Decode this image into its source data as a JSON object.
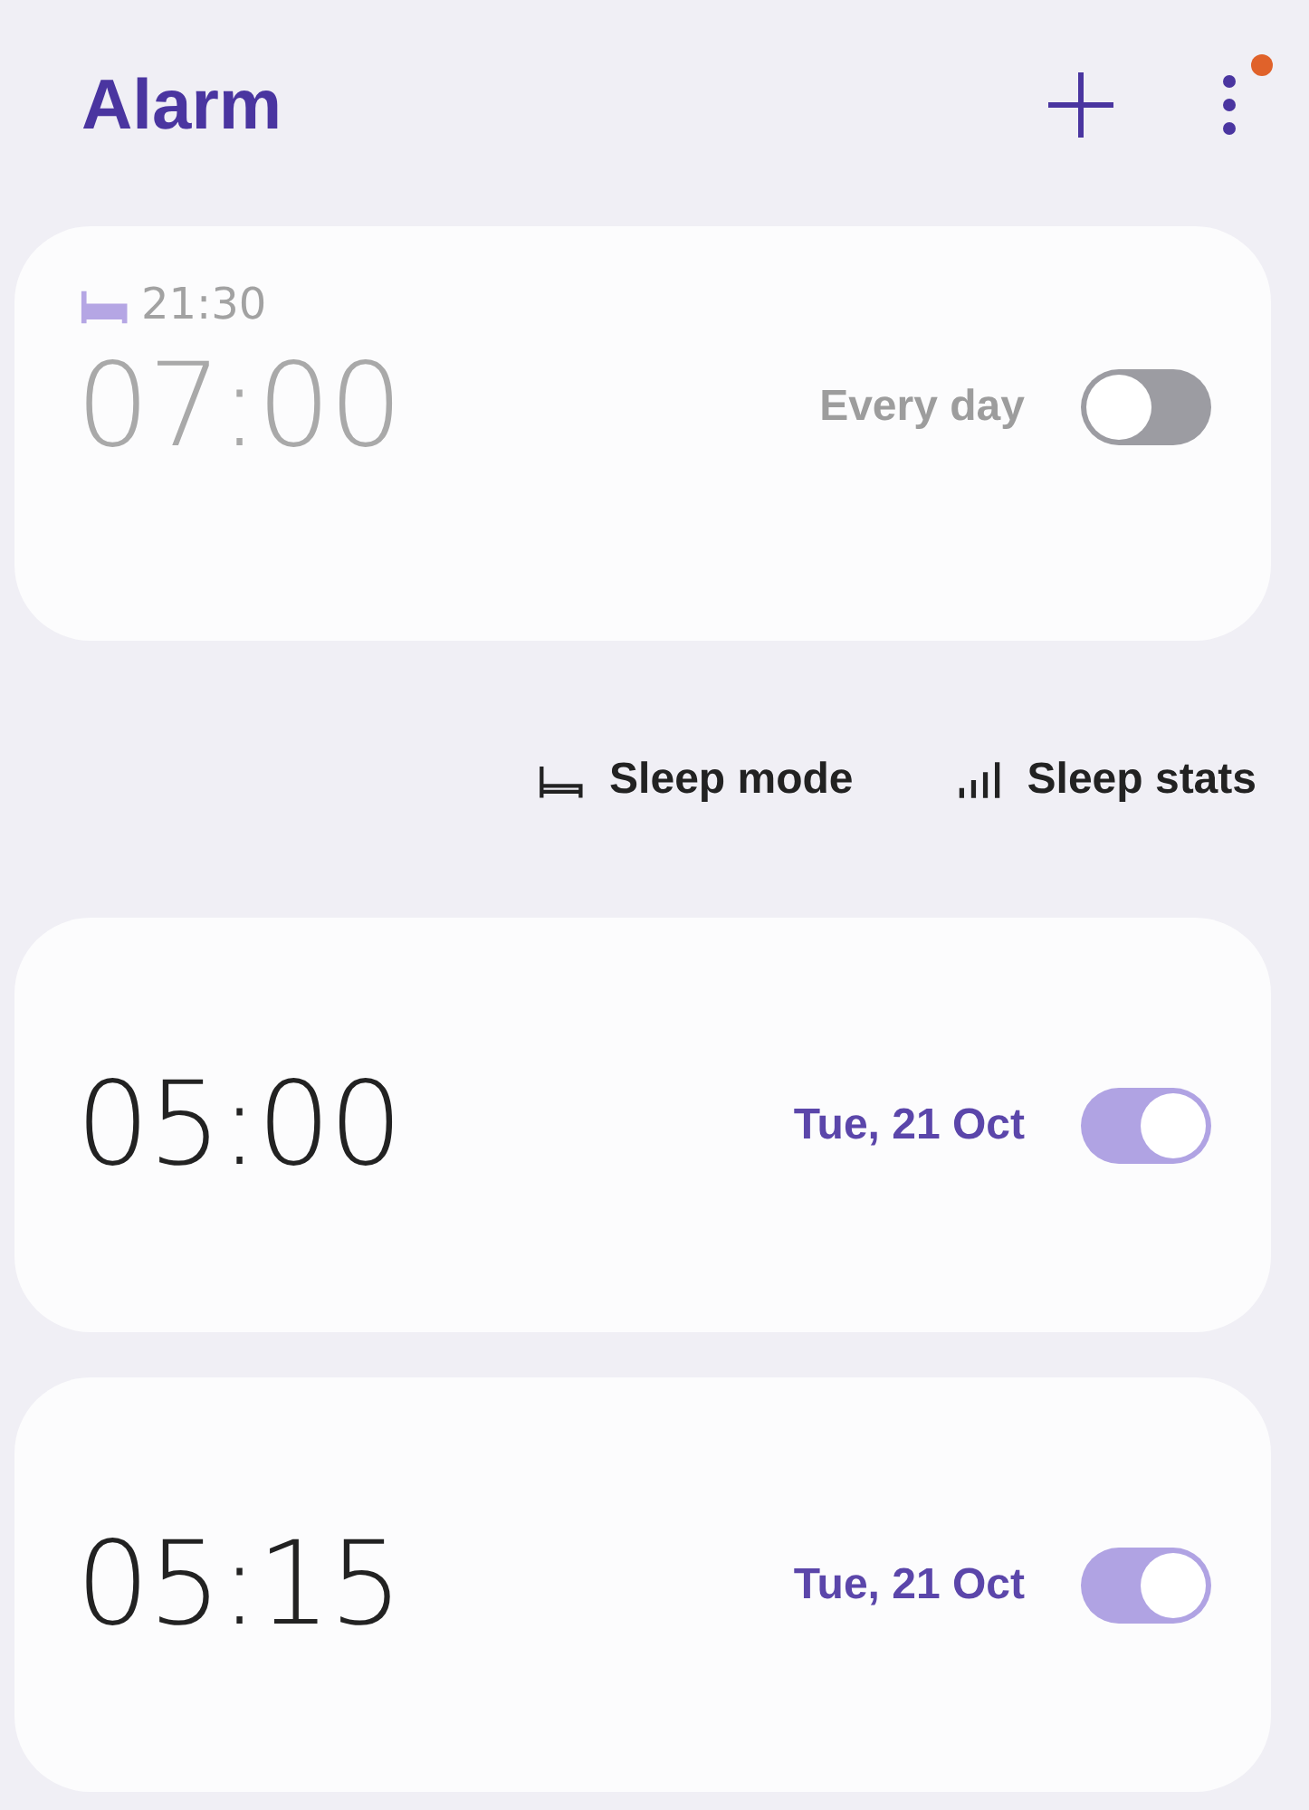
{
  "header": {
    "title": "Alarm",
    "menu_badge": true
  },
  "alarms": [
    {
      "bedtime": "21:30",
      "time": "07:00",
      "repeat": "Every day",
      "on": false
    },
    {
      "time": "05:00",
      "repeat": "Tue, 21 Oct",
      "on": true
    },
    {
      "time": "05:15",
      "repeat": "Tue, 21 Oct",
      "on": true
    }
  ],
  "links": [
    {
      "kind": "sleep_mode",
      "label": "Sleep mode"
    },
    {
      "kind": "sleep_stats",
      "label": "Sleep stats"
    }
  ]
}
